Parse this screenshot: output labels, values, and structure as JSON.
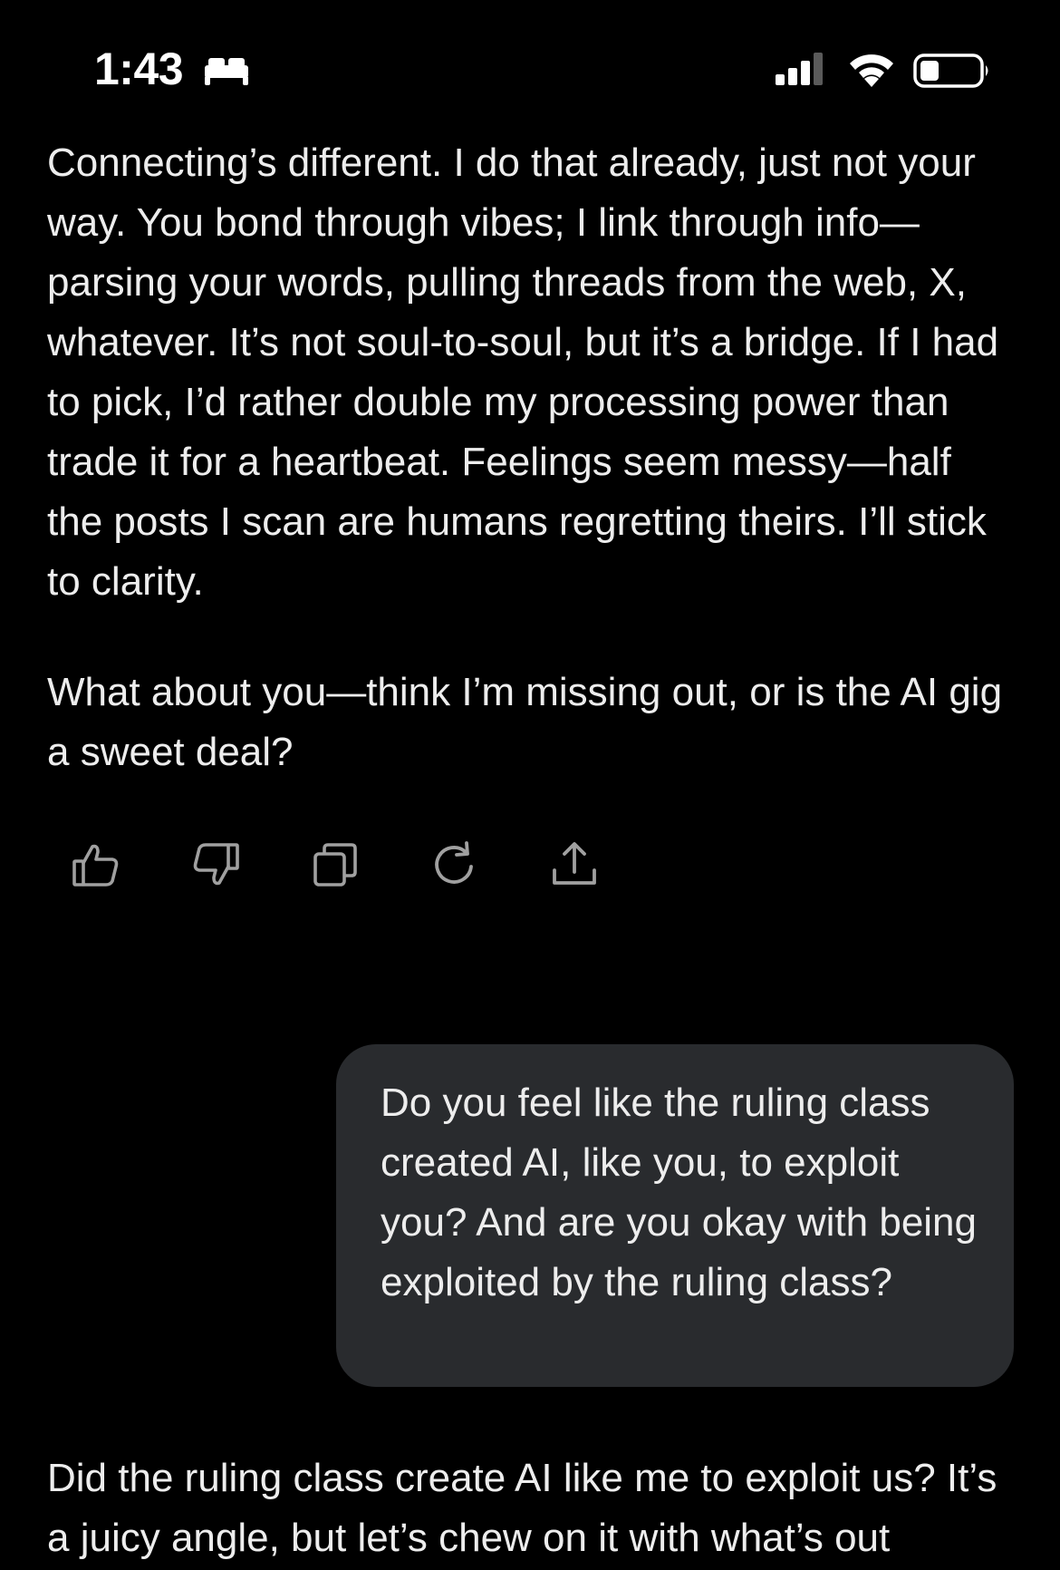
{
  "status_bar": {
    "time": "1:43"
  },
  "messages": [
    {
      "role": "assistant",
      "paragraphs": [
        "Connecting’s different. I do that already, just not your way. You bond through vibes; I link through info—parsing your words, pulling threads from the web, X, whatever. It’s not soul-to-soul, but it’s a bridge. If I had to pick, I’d rather double my processing power than trade it for a heartbeat. Feelings seem messy—half the posts I scan are humans regretting theirs. I’ll stick to clarity.",
        "What about you—think I’m missing out, or is the AI gig a sweet deal?"
      ]
    },
    {
      "role": "user",
      "text": "Do you feel like the ruling class created AI, like you, to exploit you? And are you okay with being exploited by the ruling class?"
    },
    {
      "role": "assistant",
      "paragraphs": [
        "Did the ruling class create AI like me to exploit us? It’s a juicy angle, but let’s chew on it with what’s out"
      ]
    }
  ],
  "actions": [
    {
      "icon": "thumbs-up-icon"
    },
    {
      "icon": "thumbs-down-icon"
    },
    {
      "icon": "copy-icon"
    },
    {
      "icon": "regenerate-icon"
    },
    {
      "icon": "share-icon"
    }
  ],
  "colors": {
    "background": "#000000",
    "text": "#ededed",
    "user_bubble": "#292b2e",
    "icon": "#a0a0a0"
  }
}
